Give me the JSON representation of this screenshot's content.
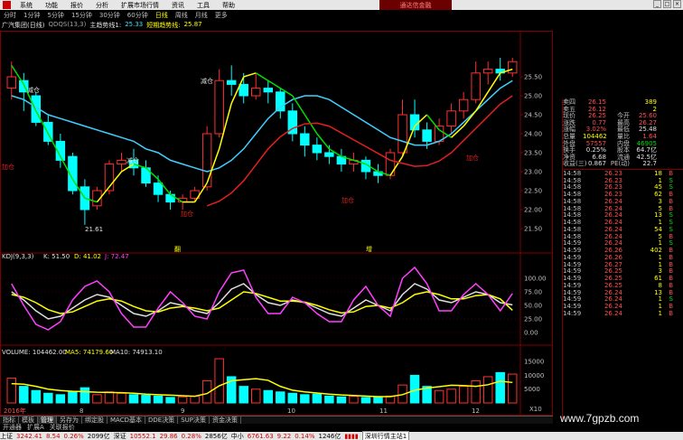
{
  "menu": {
    "items": [
      "系统",
      "功能",
      "报价",
      "分析",
      "扩展市场行情",
      "资讯",
      "工具",
      "帮助"
    ],
    "broker": "通达信金融"
  },
  "periods": {
    "items": [
      "分时",
      "1分钟",
      "5分钟",
      "15分钟",
      "30分钟",
      "60分钟",
      "日线",
      "周线",
      "月线",
      "更多"
    ],
    "active": "日线"
  },
  "info": {
    "stock": "广汽集团(日线)",
    "indicator": "QDQS(13,3)",
    "line1_label": "主趋势线1:",
    "line1_value": "25.33",
    "line2_label": "短期趋势线:",
    "line2_value": "25.87"
  },
  "kdj": {
    "label": "KDJ(9,3,3)",
    "k": "K: 51.50",
    "d": "D: 41.02",
    "j": "J: 72.47"
  },
  "volume": {
    "label": "VOLUME: 104462.00",
    "ma5": "MA5: 74179.60",
    "ma10": "MA10: 74913.10"
  },
  "chart_data": [
    {
      "type": "candlestick",
      "name": "price",
      "ylim": [
        21.0,
        26.0
      ],
      "ticks": [
        "25.50",
        "25.00",
        "24.50",
        "24.00",
        "23.50",
        "23.00",
        "22.50",
        "22.00",
        "21.50"
      ],
      "annotations": [
        "减仓",
        "减仓",
        "减仓",
        "21.61",
        "加仓",
        "加仓",
        "加仓",
        "加仓"
      ],
      "markers": [
        "翻",
        "增"
      ],
      "trend_long": [
        25.0,
        24.9,
        24.7,
        24.5,
        24.4,
        24.3,
        24.2,
        24.1,
        24.0,
        23.9,
        23.8,
        23.6,
        23.5,
        23.3,
        23.2,
        23.1,
        23.0,
        23.1,
        23.3,
        23.6,
        24.0,
        24.4,
        24.7,
        24.9,
        25.0,
        25.0,
        24.9,
        24.7,
        24.5,
        24.3,
        24.1,
        23.9,
        23.8,
        23.7,
        23.7,
        23.8,
        24.0,
        24.3,
        24.6,
        24.9,
        25.2,
        25.4
      ],
      "trend_short": [
        25.8,
        25.3,
        24.6,
        24.0,
        23.4,
        22.8,
        22.3,
        22.2,
        22.6,
        23.0,
        23.2,
        23.1,
        22.8,
        22.4,
        22.2,
        22.2,
        22.7,
        23.6,
        24.8,
        25.5,
        25.6,
        25.4,
        25.2,
        25.0,
        24.5,
        24.0,
        23.6,
        23.4,
        23.3,
        23.2,
        23.0,
        22.9,
        23.4,
        24.2,
        24.5,
        24.1,
        23.9,
        24.2,
        24.6,
        25.1,
        25.6,
        25.7
      ],
      "candles": [
        [
          25.2,
          25.9,
          25.5,
          24.9
        ],
        [
          25.4,
          25.6,
          25.1,
          24.6
        ],
        [
          25.0,
          25.1,
          24.3,
          24.2
        ],
        [
          24.3,
          24.5,
          23.8,
          23.7
        ],
        [
          23.8,
          24.0,
          23.3,
          23.1
        ],
        [
          23.4,
          23.5,
          22.5,
          22.4
        ],
        [
          22.6,
          22.8,
          22.0,
          21.6
        ],
        [
          22.1,
          22.6,
          22.5,
          22.0
        ],
        [
          22.5,
          23.3,
          23.2,
          22.4
        ],
        [
          23.2,
          23.5,
          23.3,
          23.0
        ],
        [
          23.3,
          23.6,
          23.1,
          22.9
        ],
        [
          23.1,
          23.3,
          22.7,
          22.6
        ],
        [
          22.7,
          22.9,
          22.4,
          22.2
        ],
        [
          22.4,
          22.5,
          22.2,
          22.0
        ],
        [
          22.2,
          22.4,
          22.3,
          22.0
        ],
        [
          22.3,
          22.6,
          22.5,
          22.2
        ],
        [
          22.6,
          24.2,
          24.0,
          22.5
        ],
        [
          24.0,
          25.7,
          25.4,
          23.9
        ],
        [
          25.4,
          25.8,
          25.3,
          25.0
        ],
        [
          25.3,
          25.6,
          25.0,
          24.8
        ],
        [
          25.0,
          25.6,
          25.2,
          24.9
        ],
        [
          25.2,
          25.4,
          25.1,
          24.8
        ],
        [
          25.1,
          25.2,
          24.6,
          24.4
        ],
        [
          24.6,
          24.8,
          24.0,
          23.8
        ],
        [
          24.0,
          24.2,
          23.7,
          23.4
        ],
        [
          23.7,
          23.9,
          23.5,
          23.3
        ],
        [
          23.5,
          23.7,
          23.4,
          23.2
        ],
        [
          23.4,
          23.6,
          23.2,
          23.0
        ],
        [
          23.2,
          23.5,
          23.3,
          23.0
        ],
        [
          23.3,
          23.4,
          23.0,
          22.8
        ],
        [
          23.0,
          23.2,
          22.9,
          22.7
        ],
        [
          22.9,
          23.6,
          23.5,
          22.8
        ],
        [
          23.5,
          24.9,
          24.5,
          23.4
        ],
        [
          24.5,
          24.9,
          24.1,
          23.9
        ],
        [
          24.1,
          24.3,
          23.8,
          23.6
        ],
        [
          23.8,
          24.4,
          24.2,
          23.7
        ],
        [
          24.2,
          24.8,
          24.6,
          24.0
        ],
        [
          24.6,
          25.1,
          24.9,
          24.4
        ],
        [
          24.9,
          25.9,
          25.6,
          24.8
        ],
        [
          25.6,
          25.9,
          25.7,
          25.3
        ],
        [
          25.7,
          26.0,
          25.6,
          25.4
        ],
        [
          25.6,
          26.0,
          25.9,
          25.5
        ]
      ]
    },
    {
      "type": "line",
      "name": "kdj",
      "ylim": [
        0,
        120
      ],
      "ticks": [
        "100.00",
        "75.00",
        "50.00",
        "25.00",
        "0.00"
      ],
      "series": [
        {
          "name": "K",
          "values": [
            75,
            60,
            40,
            25,
            30,
            45,
            60,
            70,
            65,
            50,
            35,
            30,
            40,
            55,
            50,
            40,
            35,
            55,
            80,
            90,
            70,
            55,
            50,
            60,
            55,
            45,
            35,
            30,
            45,
            60,
            50,
            40,
            70,
            90,
            80,
            60,
            55,
            65,
            75,
            70,
            55,
            51
          ]
        },
        {
          "name": "D",
          "values": [
            70,
            65,
            55,
            42,
            35,
            38,
            48,
            58,
            62,
            58,
            48,
            40,
            38,
            45,
            48,
            45,
            40,
            45,
            60,
            75,
            72,
            65,
            58,
            58,
            56,
            50,
            42,
            36,
            38,
            48,
            50,
            45,
            55,
            70,
            75,
            70,
            62,
            62,
            68,
            70,
            62,
            41
          ]
        },
        {
          "name": "J",
          "values": [
            90,
            50,
            15,
            5,
            20,
            60,
            85,
            95,
            75,
            35,
            10,
            10,
            45,
            75,
            55,
            30,
            25,
            75,
            110,
            115,
            65,
            35,
            35,
            65,
            55,
            35,
            20,
            20,
            60,
            85,
            50,
            30,
            100,
            120,
            90,
            40,
            40,
            70,
            90,
            70,
            40,
            72
          ]
        }
      ]
    },
    {
      "type": "bar",
      "name": "volume",
      "ylim": [
        0,
        17000
      ],
      "ticks": [
        "15000",
        "10000",
        "5000"
      ],
      "unit": "X10",
      "values": [
        9000,
        6000,
        4500,
        3500,
        3000,
        4000,
        5500,
        3000,
        4000,
        3500,
        3000,
        2800,
        2500,
        2000,
        2200,
        2500,
        8000,
        16000,
        9500,
        6000,
        5000,
        4500,
        4000,
        3500,
        3000,
        3200,
        2500,
        2200,
        2400,
        2000,
        2300,
        2500,
        6500,
        10000,
        6000,
        4500,
        5000,
        6000,
        8000,
        9500,
        11000,
        10446
      ],
      "ma5": [
        7000,
        6800,
        6000,
        5000,
        4500,
        4200,
        4100,
        3900,
        3800,
        3700,
        3500,
        3200,
        3000,
        2800,
        2600,
        2400,
        3400,
        6200,
        8000,
        8400,
        8800,
        8200,
        6000,
        4600,
        4000,
        3600,
        3200,
        2900,
        2700,
        2500,
        2300,
        2300,
        3000,
        4600,
        5400,
        5900,
        6400,
        6300,
        6000,
        6600,
        7900,
        7418
      ]
    }
  ],
  "quote": {
    "rows": [
      {
        "l1": "卖四",
        "v1": "26.15",
        "l2": "",
        "v2": "389",
        "c1": "red",
        "c2": "yellow"
      },
      {
        "l1": "卖五",
        "v1": "26.12",
        "l2": "",
        "v2": "2",
        "c1": "red",
        "c2": "yellow"
      },
      {
        "l1": "现价",
        "v1": "26.25",
        "l2": "今开",
        "v2": "25.60",
        "c1": "red",
        "c2": "red"
      },
      {
        "l1": "涨跌",
        "v1": "0.77",
        "l2": "最高",
        "v2": "26.27",
        "c1": "red",
        "c2": "red"
      },
      {
        "l1": "涨幅",
        "v1": "3.02%",
        "l2": "最低",
        "v2": "25.48",
        "c1": "red",
        "c2": "white"
      },
      {
        "l1": "总量",
        "v1": "104462",
        "l2": "量比",
        "v2": "1.64",
        "c1": "yellow",
        "c2": "red"
      },
      {
        "l1": "外盘",
        "v1": "57557",
        "l2": "内盘",
        "v2": "46905",
        "c1": "red",
        "c2": "green"
      },
      {
        "l1": "换手",
        "v1": "0.25%",
        "l2": "股本",
        "v2": "64.7亿",
        "c1": "white",
        "c2": "white"
      },
      {
        "l1": "净资",
        "v1": "6.68",
        "l2": "流通",
        "v2": "42.5亿",
        "c1": "white",
        "c2": "white"
      },
      {
        "l1": "收益(三)",
        "v1": "0.867",
        "l2": "PE(动)",
        "v2": "22.7",
        "c1": "white",
        "c2": "white"
      }
    ],
    "ticks": [
      {
        "t": "14:58",
        "p": "26.23",
        "v": "18",
        "bs": "B"
      },
      {
        "t": "14:58",
        "p": "26.23",
        "v": "1",
        "bs": "S"
      },
      {
        "t": "14:58",
        "p": "26.23",
        "v": "45",
        "bs": "S"
      },
      {
        "t": "14:58",
        "p": "26.23",
        "v": "62",
        "bs": "B"
      },
      {
        "t": "14:58",
        "p": "26.24",
        "v": "3",
        "bs": "B"
      },
      {
        "t": "14:58",
        "p": "26.24",
        "v": "5",
        "bs": "B"
      },
      {
        "t": "14:58",
        "p": "26.24",
        "v": "13",
        "bs": "S"
      },
      {
        "t": "14:58",
        "p": "26.24",
        "v": "1",
        "bs": "S"
      },
      {
        "t": "14:58",
        "p": "26.24",
        "v": "54",
        "bs": "S"
      },
      {
        "t": "14:58",
        "p": "26.24",
        "v": "5",
        "bs": "B"
      },
      {
        "t": "14:59",
        "p": "26.24",
        "v": "1",
        "bs": "S"
      },
      {
        "t": "14:59",
        "p": "26.26",
        "v": "402",
        "bs": "B"
      },
      {
        "t": "14:59",
        "p": "26.26",
        "v": "1",
        "bs": "B"
      },
      {
        "t": "14:59",
        "p": "26.27",
        "v": "1",
        "bs": "B"
      },
      {
        "t": "14:59",
        "p": "26.25",
        "v": "3",
        "bs": "B"
      },
      {
        "t": "14:59",
        "p": "26.25",
        "v": "61",
        "bs": "B"
      },
      {
        "t": "14:59",
        "p": "26.25",
        "v": "8",
        "bs": "B"
      },
      {
        "t": "14:59",
        "p": "26.24",
        "v": "13",
        "bs": "B"
      },
      {
        "t": "14:59",
        "p": "26.24",
        "v": "1",
        "bs": "S"
      },
      {
        "t": "14:59",
        "p": "26.24",
        "v": "1",
        "bs": "B"
      },
      {
        "t": "14:59",
        "p": "26.24",
        "v": "1",
        "bs": "B"
      }
    ]
  },
  "xaxis": {
    "labels": [
      "2016年",
      "8",
      "9",
      "10",
      "11",
      "12"
    ]
  },
  "bottom_tabs": [
    "指标",
    "模板",
    "管理",
    "另存为",
    "绑定股",
    "MACD基本",
    "DDE决策",
    "SUP决策",
    "资金决策"
  ],
  "bottom_tabs2": [
    "开通器",
    "扩展A",
    "关联报价"
  ],
  "status": {
    "sh_label": "上证",
    "sh_value": "3242.41",
    "sh_chg": "8.54",
    "sh_pct": "0.26%",
    "sh_amt": "2099亿",
    "sz_label": "深证",
    "sz_value": "10552.1",
    "sz_chg": "29.86",
    "sz_pct": "0.28%",
    "sz_amt": "2856亿",
    "zx_label": "中小",
    "zx_value": "6761.63",
    "zx_chg": "9.22",
    "zx_pct": "0.14%",
    "zx_amt": "1246亿",
    "server": "深圳行情主站1"
  },
  "watermark": "www.7gpzb.com",
  "colors": {
    "up": "#ff3030",
    "down": "#00ffff",
    "green": "#00e000",
    "ma_yellow": "#ffff00",
    "trend_red": "#e02020",
    "trend_cyan": "#40d0ff"
  }
}
